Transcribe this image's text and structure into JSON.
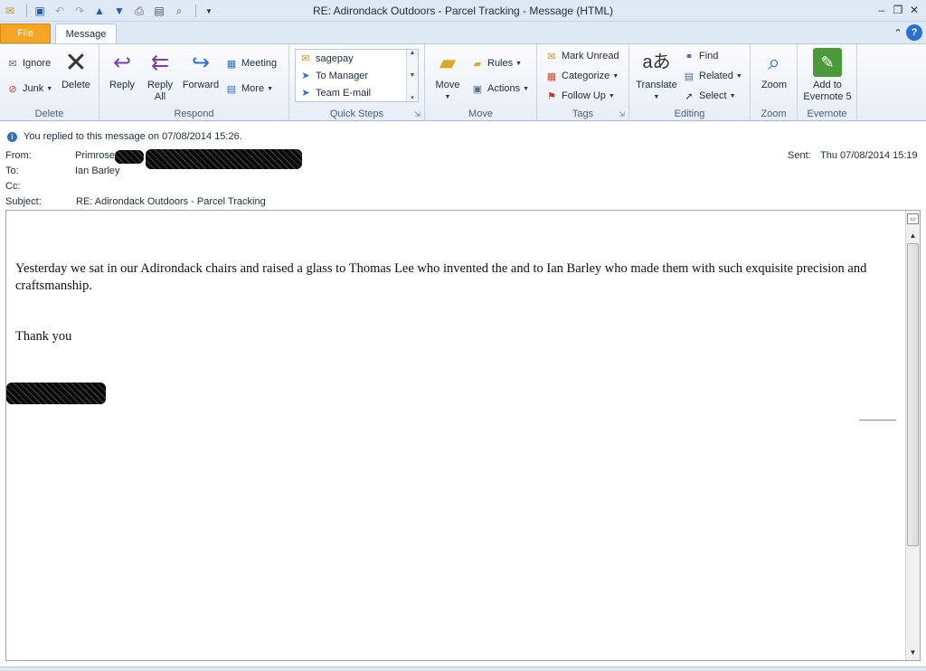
{
  "window": {
    "title": "RE: Adirondack Outdoors - Parcel Tracking  -  Message (HTML)"
  },
  "tabs": {
    "file": "File",
    "message": "Message"
  },
  "ribbon": {
    "delete_group": {
      "label": "Delete",
      "ignore": "Ignore",
      "junk": "Junk",
      "delete": "Delete"
    },
    "respond_group": {
      "label": "Respond",
      "reply": "Reply",
      "reply_all_1": "Reply",
      "reply_all_2": "All",
      "forward": "Forward",
      "meeting": "Meeting",
      "more": "More"
    },
    "quicksteps_group": {
      "label": "Quick Steps",
      "items": [
        "sagepay",
        "To Manager",
        "Team E-mail"
      ]
    },
    "move_group": {
      "label": "Move",
      "move": "Move",
      "rules": "Rules",
      "actions": "Actions"
    },
    "tags_group": {
      "label": "Tags",
      "mark_unread": "Mark Unread",
      "categorize": "Categorize",
      "follow_up": "Follow Up"
    },
    "editing_group": {
      "label": "Editing",
      "translate": "Translate",
      "find": "Find",
      "related": "Related",
      "select": "Select"
    },
    "zoom_group": {
      "label": "Zoom",
      "zoom": "Zoom"
    },
    "evernote_group": {
      "label": "Evernote",
      "add_1": "Add to",
      "add_2": "Evernote 5"
    }
  },
  "info_bar": "You replied to this message on 07/08/2014 15:26.",
  "header": {
    "from_label": "From:",
    "from_value": "Primrose",
    "to_label": "To:",
    "to_value": "Ian Barley",
    "cc_label": "Cc:",
    "subject_label": "Subject:",
    "subject_value": "RE: Adirondack Outdoors - Parcel Tracking",
    "sent_label": "Sent:",
    "sent_value": "Thu 07/08/2014 15:19"
  },
  "body": {
    "paragraph": "Yesterday we sat in our Adirondack chairs and raised a glass to Thomas Lee who invented the and to Ian Barley who made them with such exquisite precision and craftsmanship.",
    "closing": "Thank you"
  },
  "colors": {
    "file_tab": "#f5a524",
    "ribbon_bg": "#e8eef7",
    "accent": "#2b6fd1"
  }
}
